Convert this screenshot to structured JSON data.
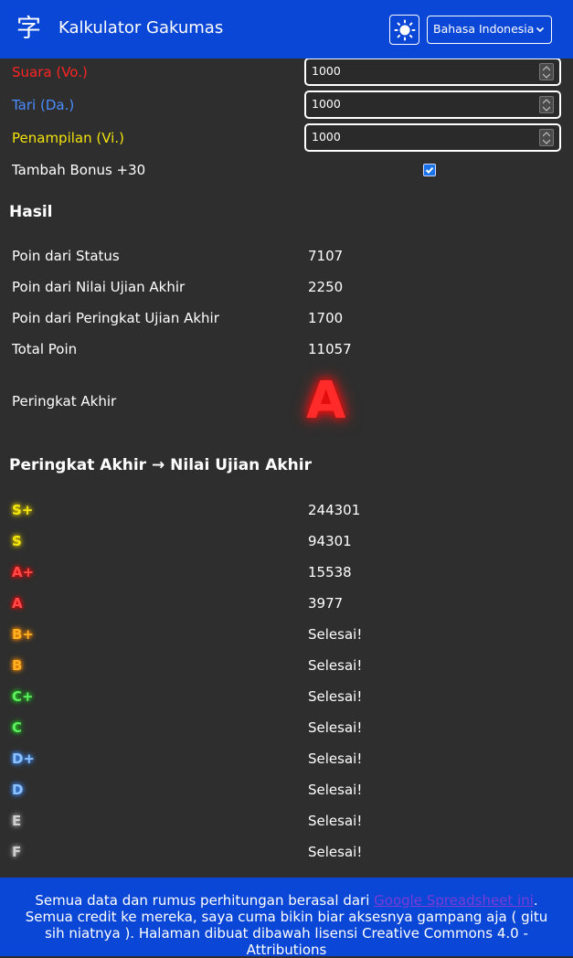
{
  "header": {
    "logo_glyph": "字",
    "title": "Kalkulator Gakumas",
    "theme_icon": "sun-icon",
    "language": "Bahasa Indonesia"
  },
  "stats": [
    {
      "label": "Suara (Vo.)",
      "value": "1000",
      "color": "#ff2424"
    },
    {
      "label": "Tari (Da.)",
      "value": "1000",
      "color": "#4a8dff"
    },
    {
      "label": "Penampilan (Vi.)",
      "value": "1000",
      "color": "#f2e30c"
    }
  ],
  "bonus": {
    "label": "Tambah Bonus +30",
    "checked": true
  },
  "results": {
    "title": "Hasil",
    "rows": [
      {
        "label": "Poin dari Status",
        "value": "7107"
      },
      {
        "label": "Poin dari Nilai Ujian Akhir",
        "value": "2250"
      },
      {
        "label": "Poin dari Peringkat Ujian Akhir",
        "value": "1700"
      },
      {
        "label": "Total Poin",
        "value": "11057"
      }
    ],
    "final_rank_label": "Peringkat Akhir",
    "final_rank": "A"
  },
  "rank_table": {
    "title": "Peringkat Akhir → Nilai Ujian Akhir",
    "rows": [
      {
        "grade": "S+",
        "value": "244301",
        "color": "#f5e60f",
        "glow": "#d6c600"
      },
      {
        "grade": "S",
        "value": "94301",
        "color": "#f5e60f",
        "glow": "#d6c600"
      },
      {
        "grade": "A+",
        "value": "15538",
        "color": "#ff4a4a",
        "glow": "#ff0000"
      },
      {
        "grade": "A",
        "value": "3977",
        "color": "#ff4a4a",
        "glow": "#ff0000"
      },
      {
        "grade": "B+",
        "value": "Selesai!",
        "color": "#ffb020",
        "glow": "#ff8c00"
      },
      {
        "grade": "B",
        "value": "Selesai!",
        "color": "#ffb020",
        "glow": "#ff8c00"
      },
      {
        "grade": "C+",
        "value": "Selesai!",
        "color": "#5ef05e",
        "glow": "#1fd11f"
      },
      {
        "grade": "C",
        "value": "Selesai!",
        "color": "#5ef05e",
        "glow": "#1fd11f"
      },
      {
        "grade": "D+",
        "value": "Selesai!",
        "color": "#8ec3ff",
        "glow": "#3a8cff"
      },
      {
        "grade": "D",
        "value": "Selesai!",
        "color": "#8ec3ff",
        "glow": "#3a8cff"
      },
      {
        "grade": "E",
        "value": "Selesai!",
        "color": "#cfcfcf",
        "glow": "#9a9a9a"
      },
      {
        "grade": "F",
        "value": "Selesai!",
        "color": "#cfcfcf",
        "glow": "#9a9a9a"
      }
    ]
  },
  "footer": {
    "text_before": "Semua data dan rumus perhitungan berasal dari ",
    "link": "Google Spreadsheet ini",
    "text_after": ". Semua credit ke mereka, saya cuma bikin biar aksesnya gampang aja ( gitu sih niatnya ). Halaman dibuat dibawah lisensi Creative Commons 4.0 - Attributions"
  }
}
